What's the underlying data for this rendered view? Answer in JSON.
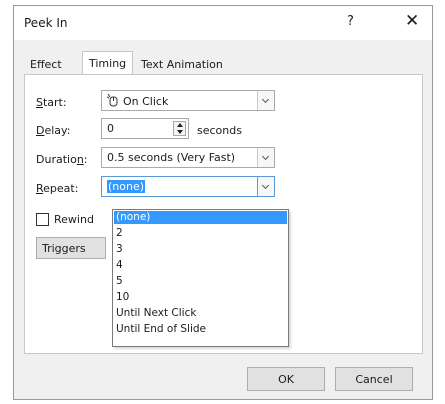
{
  "dialog": {
    "title": "Peek In",
    "help_label": "?",
    "close_label": "✕"
  },
  "tabs": [
    {
      "label": "Effect"
    },
    {
      "label": "Timing"
    },
    {
      "label": "Text Animation"
    }
  ],
  "timing": {
    "start_label": "Start:",
    "start_value": "On Click",
    "delay_label": "Delay:",
    "delay_value": "0",
    "delay_unit": "seconds",
    "duration_label": "Duration:",
    "duration_value": "0.5 seconds (Very Fast)",
    "repeat_label": "Repeat:",
    "repeat_value": "(none)",
    "rewind_label": "Rewind",
    "triggers_label": "Triggers"
  },
  "repeat_options": [
    "(none)",
    "2",
    "3",
    "4",
    "5",
    "10",
    "Until Next Click",
    "Until End of Slide"
  ],
  "buttons": {
    "ok": "OK",
    "cancel": "Cancel"
  },
  "colors": {
    "selection": "#3399ff"
  }
}
